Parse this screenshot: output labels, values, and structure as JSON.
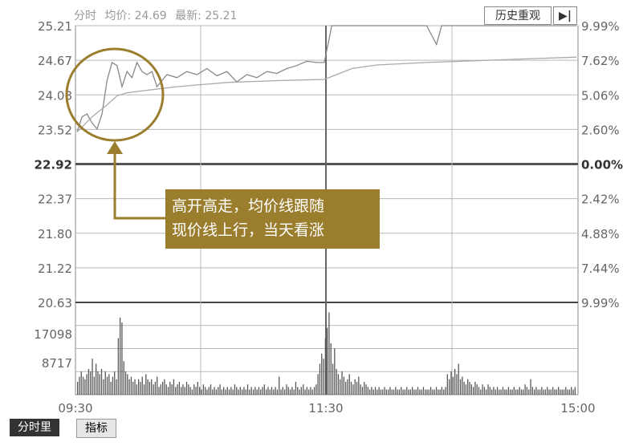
{
  "header": {
    "mode_label": "分时",
    "avg_label": "均价: 24.69",
    "last_label": "最新: 25.21",
    "history_button": "历史重观",
    "next_icon": "▶|"
  },
  "annotation": {
    "line1": "高开高走，均价线跟随",
    "line2": "现价线上行，当天看涨"
  },
  "tabs": [
    {
      "label": "分时里"
    },
    {
      "label": "指标"
    }
  ],
  "colors": {
    "grid": "#b8b8b8",
    "baseline": "#555555",
    "price_line": "#888888",
    "avg_line": "#aaaaaa",
    "volume": "#555555",
    "accent": "#9b7d2e"
  },
  "chart_data": {
    "type": "line",
    "left_ticks": [
      "25.21",
      "24.67",
      "24.08",
      "23.52",
      "22.92",
      "22.37",
      "21.80",
      "21.22",
      "20.63"
    ],
    "right_ticks": [
      "9.99%",
      "7.62%",
      "5.06%",
      "2.60%",
      "0.00%",
      "2.42%",
      "4.88%",
      "7.44%",
      "9.99%"
    ],
    "y_range": [
      20.63,
      25.21
    ],
    "prev_close": 22.92,
    "x_ticks": [
      "09:30",
      "11:30",
      "15:00"
    ],
    "volume_ticks": [
      "17098",
      "8717"
    ],
    "price_series": [
      [
        0,
        23.45
      ],
      [
        0.01,
        23.7
      ],
      [
        0.02,
        23.75
      ],
      [
        0.03,
        23.6
      ],
      [
        0.04,
        23.5
      ],
      [
        0.05,
        23.75
      ],
      [
        0.06,
        24.3
      ],
      [
        0.07,
        24.6
      ],
      [
        0.08,
        24.55
      ],
      [
        0.09,
        24.2
      ],
      [
        0.1,
        24.45
      ],
      [
        0.11,
        24.35
      ],
      [
        0.12,
        24.6
      ],
      [
        0.13,
        24.45
      ],
      [
        0.14,
        24.4
      ],
      [
        0.15,
        24.45
      ],
      [
        0.16,
        24.2
      ],
      [
        0.17,
        24.3
      ],
      [
        0.18,
        24.4
      ],
      [
        0.2,
        24.35
      ],
      [
        0.22,
        24.45
      ],
      [
        0.24,
        24.4
      ],
      [
        0.26,
        24.5
      ],
      [
        0.28,
        24.38
      ],
      [
        0.3,
        24.45
      ],
      [
        0.32,
        24.28
      ],
      [
        0.34,
        24.4
      ],
      [
        0.36,
        24.35
      ],
      [
        0.38,
        24.45
      ],
      [
        0.4,
        24.42
      ],
      [
        0.42,
        24.5
      ],
      [
        0.44,
        24.55
      ],
      [
        0.46,
        24.62
      ],
      [
        0.48,
        24.6
      ],
      [
        0.495,
        24.6
      ],
      [
        0.505,
        25.0
      ],
      [
        0.51,
        25.21
      ],
      [
        0.52,
        25.21
      ],
      [
        0.7,
        25.21
      ],
      [
        0.72,
        24.9
      ],
      [
        0.73,
        25.21
      ],
      [
        1.0,
        25.21
      ]
    ],
    "avg_series": [
      [
        0,
        23.45
      ],
      [
        0.03,
        23.7
      ],
      [
        0.06,
        23.9
      ],
      [
        0.08,
        24.05
      ],
      [
        0.1,
        24.1
      ],
      [
        0.15,
        24.15
      ],
      [
        0.2,
        24.2
      ],
      [
        0.3,
        24.27
      ],
      [
        0.4,
        24.3
      ],
      [
        0.495,
        24.32
      ],
      [
        0.52,
        24.4
      ],
      [
        0.55,
        24.5
      ],
      [
        0.6,
        24.56
      ],
      [
        0.7,
        24.6
      ],
      [
        0.8,
        24.63
      ],
      [
        0.9,
        24.66
      ],
      [
        1.0,
        24.69
      ]
    ],
    "volume": [
      5,
      7,
      9,
      7,
      6,
      8,
      10,
      9,
      14,
      7,
      12,
      9,
      8,
      10,
      6,
      9,
      7,
      8,
      5,
      7,
      9,
      6,
      22,
      30,
      28,
      13,
      9,
      8,
      6,
      7,
      5,
      6,
      4,
      6,
      5,
      7,
      4,
      8,
      6,
      5,
      6,
      4,
      5,
      7,
      3,
      4,
      5,
      6,
      4,
      3,
      5,
      4,
      6,
      3,
      4,
      5,
      3,
      4,
      3,
      5,
      4,
      3,
      2,
      4,
      3,
      5,
      3,
      2,
      4,
      3,
      2,
      3,
      4,
      2,
      3,
      2,
      3,
      4,
      2,
      3,
      2,
      3,
      2,
      3,
      2,
      4,
      3,
      2,
      3,
      2,
      3,
      2,
      4,
      2,
      3,
      2,
      3,
      2,
      3,
      2,
      3,
      4,
      2,
      3,
      2,
      3,
      2,
      3,
      2,
      7,
      2,
      3,
      2,
      4,
      3,
      2,
      3,
      2,
      5,
      3,
      2,
      3,
      4,
      2,
      3,
      2,
      3,
      2,
      3,
      4,
      8,
      12,
      16,
      14,
      22,
      26,
      32,
      20,
      12,
      18,
      10,
      8,
      6,
      9,
      7,
      5,
      6,
      8,
      5,
      4,
      6,
      5,
      7,
      4,
      3,
      5,
      4,
      3,
      2,
      3,
      2,
      3,
      2,
      3,
      2,
      2,
      3,
      2,
      2,
      3,
      2,
      2,
      3,
      2,
      2,
      3,
      2,
      2,
      3,
      2,
      2,
      3,
      2,
      2,
      3,
      2,
      2,
      3,
      2,
      2,
      2,
      3,
      2,
      2,
      3,
      2,
      2,
      3,
      2,
      3,
      8,
      6,
      9,
      7,
      10,
      8,
      12,
      6,
      7,
      5,
      4,
      6,
      5,
      4,
      3,
      5,
      4,
      3,
      2,
      4,
      3,
      2,
      4,
      3,
      2,
      3,
      2,
      3,
      2,
      2,
      3,
      2,
      2,
      3,
      2,
      2,
      3,
      2,
      2,
      3,
      2,
      2,
      4,
      3,
      2,
      6,
      3,
      2,
      3,
      2,
      2,
      3,
      2,
      2,
      3,
      2,
      2,
      3,
      2,
      2,
      3,
      2,
      2,
      2,
      3,
      2,
      2,
      3,
      2,
      3
    ],
    "volume_max": 34
  }
}
